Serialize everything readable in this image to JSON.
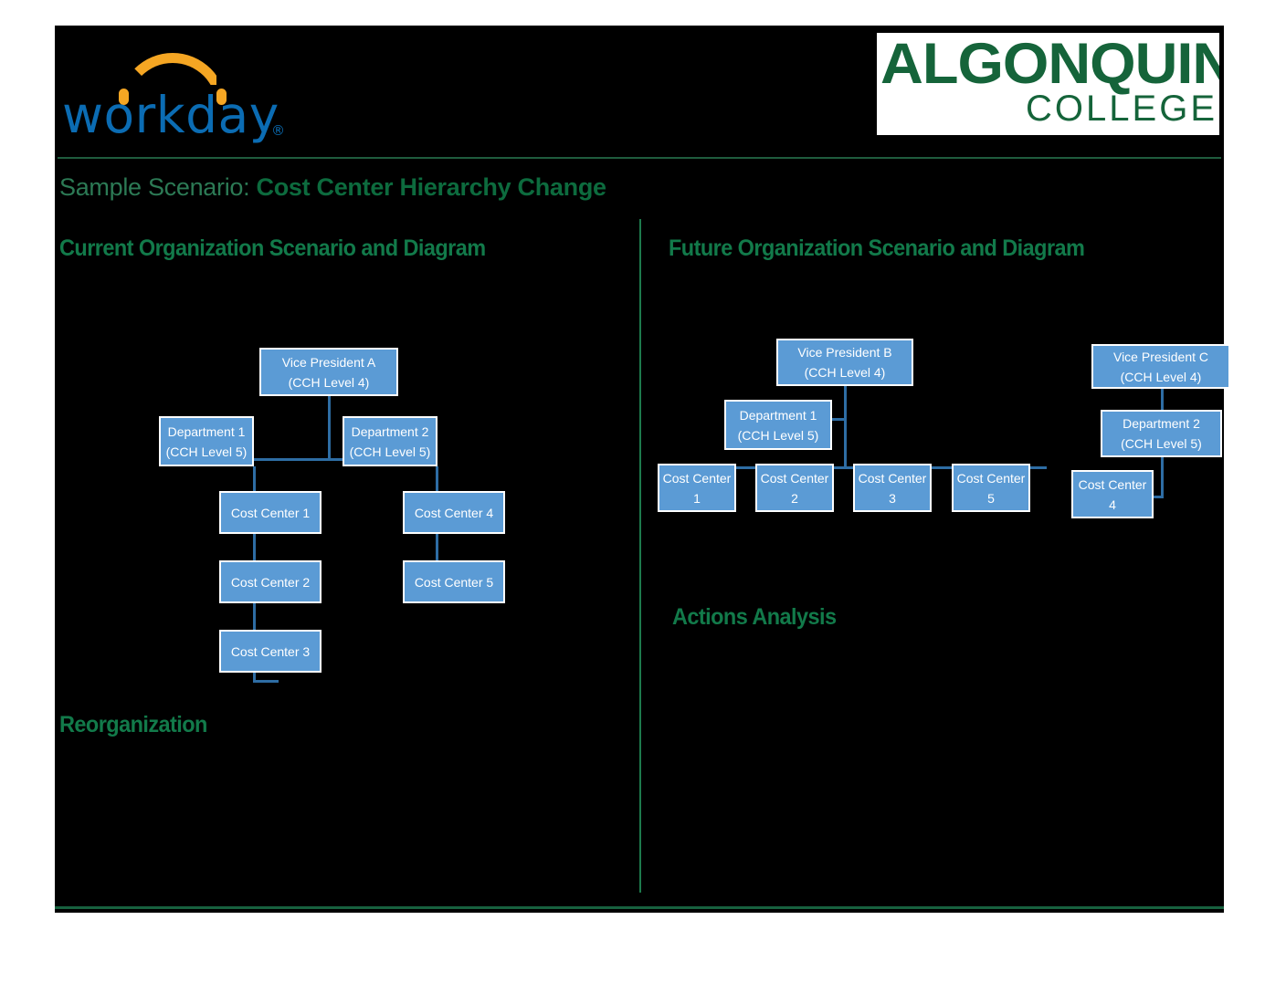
{
  "branding": {
    "workday_wordmark": "workday",
    "workday_registered": "®",
    "algonquin_line1": "ALGONQUIN",
    "algonquin_line2": "COLLEGE",
    "green": "#15643a",
    "workday_blue": "#0b6cb3",
    "workday_orange": "#f5a623"
  },
  "title": {
    "prefix": "Sample Scenario: ",
    "subject": "Cost Center Hierarchy Change"
  },
  "sections": {
    "current": "Current Organization Scenario and Diagram",
    "future": "Future Organization Scenario and Diagram",
    "reorganization": "Reorganization",
    "actions_analysis": "Actions Analysis"
  },
  "current_org": {
    "vp": {
      "line1": "Vice President A",
      "line2": "(CCH Level 4)"
    },
    "dept1": {
      "line1": "Department 1",
      "line2": "(CCH Level 5)"
    },
    "dept2": {
      "line1": "Department 2",
      "line2": "(CCH Level 5)"
    },
    "cc1": "Cost Center 1",
    "cc2": "Cost Center 2",
    "cc3": "Cost Center 3",
    "cc4": "Cost Center 4",
    "cc5": "Cost Center 5"
  },
  "future_org": {
    "vpb": {
      "line1": "Vice President B",
      "line2": "(CCH Level 4)"
    },
    "vpc": {
      "line1": "Vice President C",
      "line2": "(CCH Level 4)"
    },
    "dept1": {
      "line1": "Department 1",
      "line2": "(CCH Level 5)"
    },
    "dept2": {
      "line1": "Department 2",
      "line2": "(CCH Level 5)"
    },
    "cc1": {
      "line1": "Cost Center",
      "line2": "1"
    },
    "cc2": {
      "line1": "Cost Center",
      "line2": "2"
    },
    "cc3": {
      "line1": "Cost Center",
      "line2": "3"
    },
    "cc5": {
      "line1": "Cost Center",
      "line2": "5"
    },
    "cc4": {
      "line1": "Cost Center",
      "line2": "4"
    }
  },
  "colors": {
    "node_fill": "#5b9bd5",
    "node_border": "#ffffff",
    "connector": "#2e6da4",
    "slide_background": "#000000",
    "heading_green": "#127a4a"
  }
}
